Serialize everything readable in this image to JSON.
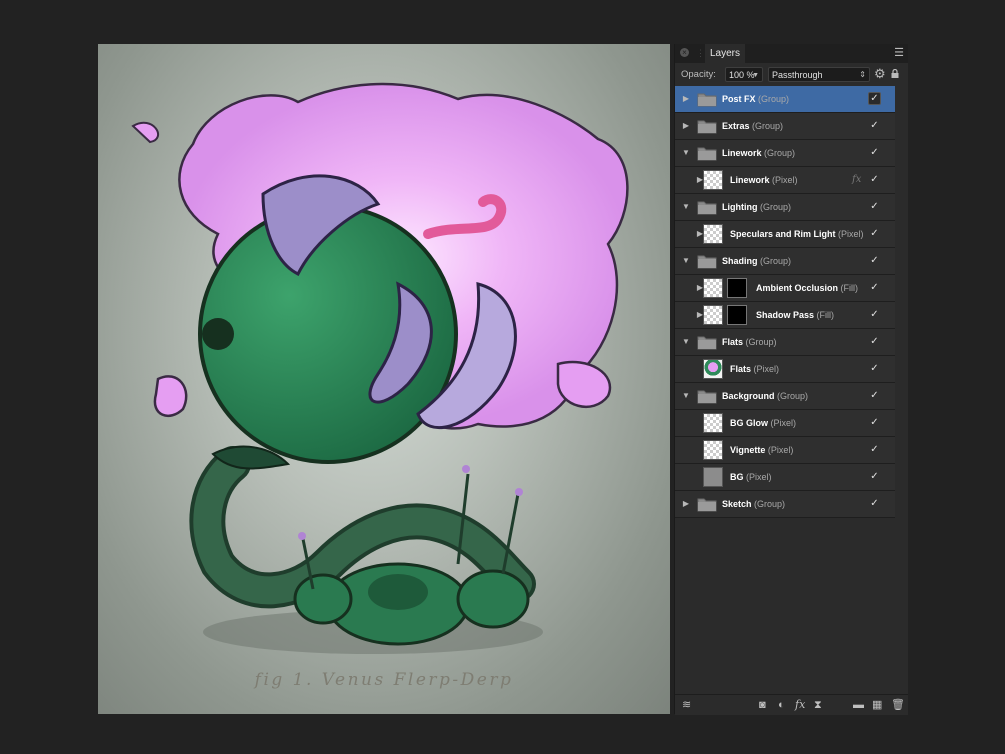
{
  "canvas": {
    "caption": "fig 1. Venus Flerp-Derp"
  },
  "panel": {
    "tab_label": "Layers",
    "opacity_label": "Opacity:",
    "opacity_value": "100 %",
    "blend_mode": "Passthrough"
  },
  "layers": [
    {
      "name": "Post FX",
      "type": "(Group)",
      "kind": "group",
      "depth": 0,
      "expanded": false,
      "selected": true,
      "visible": true
    },
    {
      "name": "Extras",
      "type": "(Group)",
      "kind": "group",
      "depth": 0,
      "expanded": false,
      "selected": false,
      "visible": true
    },
    {
      "name": "Linework",
      "type": "(Group)",
      "kind": "group",
      "depth": 0,
      "expanded": true,
      "selected": false,
      "visible": true
    },
    {
      "name": "Linework",
      "type": "(Pixel)",
      "kind": "pixel",
      "depth": 1,
      "expanded": false,
      "selected": false,
      "visible": true,
      "fx": true
    },
    {
      "name": "Lighting",
      "type": "(Group)",
      "kind": "group",
      "depth": 0,
      "expanded": true,
      "selected": false,
      "visible": true
    },
    {
      "name": "Speculars and Rim Light",
      "type": "(Pixel)",
      "kind": "pixel",
      "depth": 1,
      "expanded": false,
      "selected": false,
      "visible": true
    },
    {
      "name": "Shading",
      "type": "(Group)",
      "kind": "group",
      "depth": 0,
      "expanded": true,
      "selected": false,
      "visible": true
    },
    {
      "name": "Ambient Occlusion",
      "type": "(Fill)",
      "kind": "fill",
      "depth": 1,
      "expanded": false,
      "selected": false,
      "visible": true
    },
    {
      "name": "Shadow Pass",
      "type": "(Fill)",
      "kind": "fill",
      "depth": 1,
      "expanded": false,
      "selected": false,
      "visible": true
    },
    {
      "name": "Flats",
      "type": "(Group)",
      "kind": "group",
      "depth": 0,
      "expanded": true,
      "selected": false,
      "visible": true
    },
    {
      "name": "Flats",
      "type": "(Pixel)",
      "kind": "pixel-art",
      "depth": 1,
      "expanded": null,
      "selected": false,
      "visible": true
    },
    {
      "name": "Background",
      "type": "(Group)",
      "kind": "group",
      "depth": 0,
      "expanded": true,
      "selected": false,
      "visible": true
    },
    {
      "name": "BG Glow",
      "type": "(Pixel)",
      "kind": "pixel",
      "depth": 1,
      "expanded": null,
      "selected": false,
      "visible": true
    },
    {
      "name": "Vignette",
      "type": "(Pixel)",
      "kind": "pixel",
      "depth": 1,
      "expanded": null,
      "selected": false,
      "visible": true
    },
    {
      "name": "BG",
      "type": "(Pixel)",
      "kind": "pixel-gray",
      "depth": 1,
      "expanded": null,
      "selected": false,
      "visible": true
    },
    {
      "name": "Sketch",
      "type": "(Group)",
      "kind": "group",
      "depth": 0,
      "expanded": false,
      "selected": false,
      "visible": true
    }
  ],
  "footer_icons": [
    "layers-stack-icon",
    "mask-icon",
    "adjustment-icon",
    "fx-icon",
    "hourglass-icon",
    "folder-icon",
    "checker-layer-icon",
    "trash-icon"
  ],
  "colors": {
    "selected_row": "#3e6aa4",
    "panel_bg": "#2b2b2b",
    "app_bg": "#222222",
    "plant_green": "#2f8a5a",
    "plant_glow_pink": "#e59ef2"
  }
}
